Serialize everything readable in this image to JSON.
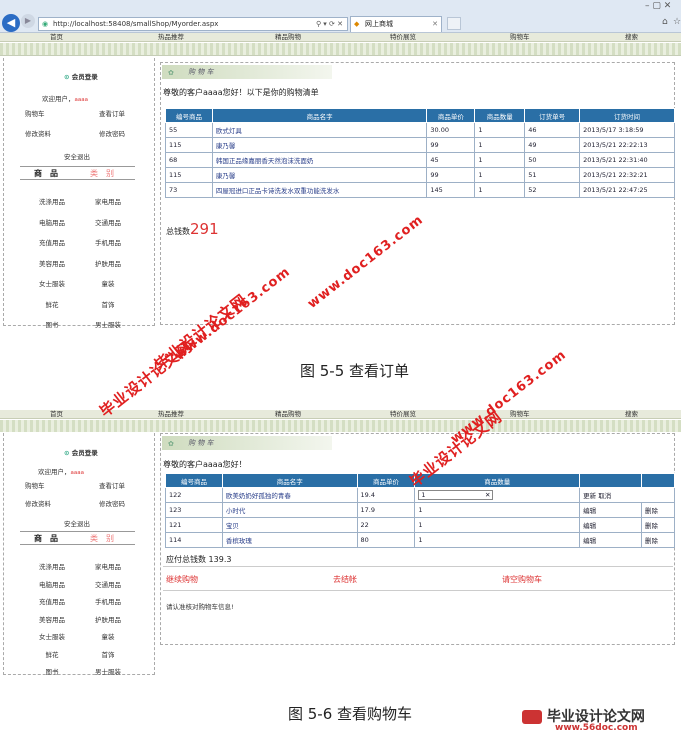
{
  "browser": {
    "url": "http://localhost:58408/smallShop/Myorder.aspx",
    "tab_title": "网上商城"
  },
  "nav": [
    "首页",
    "热品推荐",
    "精品购物",
    "特价展览",
    "购物车",
    "搜索"
  ],
  "sidebar": {
    "login_title": "会员登录",
    "welcome": "欢迎用户，",
    "username": "aaaa",
    "links": [
      "购物车",
      "查看订单",
      "修改资料",
      "修改密码"
    ],
    "logout": "安全退出",
    "cat_title_a": "商　品",
    "cat_title_b": "类　别",
    "categories": [
      [
        "洗涤用品",
        "家电用品"
      ],
      [
        "电脑用品",
        "交通用品"
      ],
      [
        "充值用品",
        "手机用品"
      ],
      [
        "美容用品",
        "护肤用品"
      ],
      [
        "女士服装",
        "童装"
      ],
      [
        "鲜花",
        "首饰"
      ],
      [
        "图书",
        "男士服装"
      ]
    ]
  },
  "orders": {
    "header": "购 物 车",
    "greeting": "尊敬的客户aaaa您好！以下是你的购物清单",
    "columns": [
      "编号商品",
      "商品名字",
      "商品单价",
      "商品数量",
      "订货单号",
      "订货时间"
    ],
    "rows": [
      [
        "55",
        "欧式灯具",
        "30.00",
        "1",
        "46",
        "2013/5/17 3:18:59"
      ],
      [
        "115",
        "康乃馨",
        "99",
        "1",
        "49",
        "2013/5/21 22:22:13"
      ],
      [
        "68",
        "韩国正品缘嘉丽香天然泡沫洗面奶",
        "45",
        "1",
        "50",
        "2013/5/21 22:31:40"
      ],
      [
        "115",
        "康乃馨",
        "99",
        "1",
        "51",
        "2013/5/21 22:32:21"
      ],
      [
        "73",
        "四屋冠进口正品卡诗洗发水双重功能洗发水",
        "145",
        "1",
        "52",
        "2013/5/21 22:47:25"
      ]
    ],
    "total_label": "总钱数",
    "total_value": "291"
  },
  "caption1": "图 5-5  查看订单",
  "cart": {
    "header": "购 物 车",
    "greeting": "尊敬的客户aaaa您好！",
    "columns": [
      "编号商品",
      "商品名字",
      "商品单价",
      "商品数量"
    ],
    "rows": [
      [
        "122",
        "欧美奶奶好孤独的青春",
        "19.4",
        "1",
        "更新",
        "取消"
      ],
      [
        "123",
        "小时代",
        "17.9",
        "1",
        "编辑",
        "删除"
      ],
      [
        "121",
        "宝贝",
        "22",
        "1",
        "编辑",
        "删除"
      ],
      [
        "114",
        "香槟玫瑰",
        "80",
        "1",
        "编辑",
        "删除"
      ]
    ],
    "total_label": "应付总钱数",
    "total_value": "139.3",
    "actions": [
      "继续购物",
      "去结帐",
      "请空购物车"
    ],
    "note": "请认准核对购物车信息!"
  },
  "caption2": "图 5-6  查看购物车",
  "watermarks": {
    "site_cn": "毕业设计论文网",
    "site_url": "www.doc163.com",
    "logo_cn": "毕业设计论文网",
    "logo_url": "www.56doc.com"
  }
}
